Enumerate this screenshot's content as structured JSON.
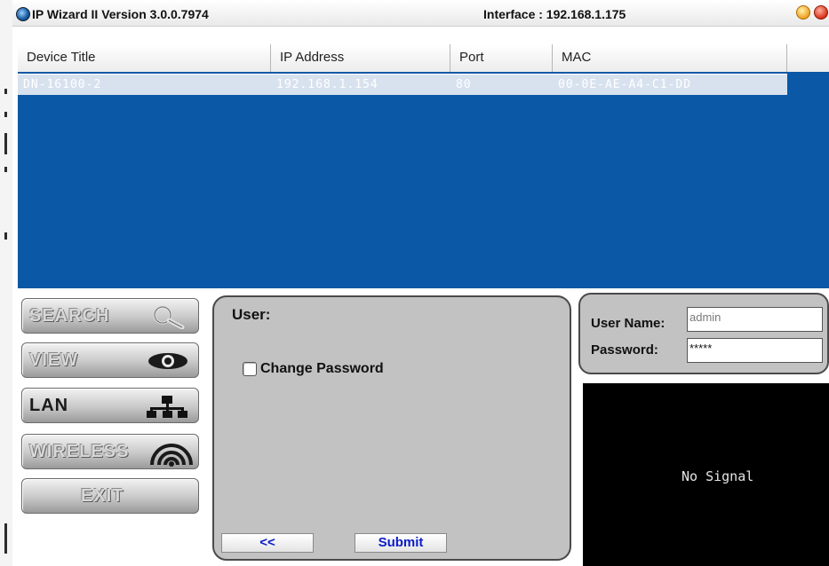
{
  "window": {
    "title": "IP Wizard II  Version 3.0.0.7974",
    "interface": "Interface : 192.168.1.175"
  },
  "table": {
    "columns": [
      "Device Title",
      "IP Address",
      "Port",
      "MAC"
    ],
    "rows": [
      [
        "DN-16100-2",
        "192.168.1.154",
        "80",
        "00-0E-AE-A4-C1-DD"
      ]
    ],
    "selected_row_color": "#d8e2ef",
    "background_color": "#0a58a6"
  },
  "nav": {
    "search": "SEARCH",
    "view": "VIEW",
    "lan": "LAN",
    "wireless": "WIRELESS",
    "exit": "EXIT",
    "active": "LAN"
  },
  "user_panel": {
    "heading": "User:",
    "change_password": "Change Password",
    "change_password_checked": false,
    "back_button": "<<",
    "submit_button": "Submit"
  },
  "login": {
    "username_label": "User Name:",
    "username_value": "admin",
    "password_label": "Password:",
    "password_value": "*****"
  },
  "video": {
    "status": "No Signal"
  }
}
